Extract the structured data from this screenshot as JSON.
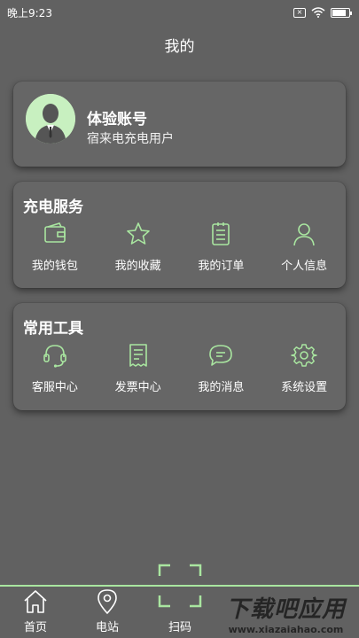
{
  "status_bar": {
    "time": "晚上9:23",
    "sim_label": "×"
  },
  "header": {
    "title": "我的"
  },
  "account": {
    "name": "体验账号",
    "subtitle": "宿来电充电用户"
  },
  "charging_service": {
    "title": "充电服务",
    "items": [
      {
        "label": "我的钱包",
        "icon": "wallet-icon"
      },
      {
        "label": "我的收藏",
        "icon": "star-icon"
      },
      {
        "label": "我的订单",
        "icon": "order-icon"
      },
      {
        "label": "个人信息",
        "icon": "person-icon"
      }
    ]
  },
  "tools": {
    "title": "常用工具",
    "items": [
      {
        "label": "客服中心",
        "icon": "headset-icon"
      },
      {
        "label": "发票中心",
        "icon": "invoice-icon"
      },
      {
        "label": "我的消息",
        "icon": "message-icon"
      },
      {
        "label": "系统设置",
        "icon": "gear-icon"
      }
    ]
  },
  "bottom_nav": {
    "home": "首页",
    "station": "电站",
    "scan": "扫码"
  },
  "watermark": {
    "title": "下载吧应用",
    "url": "www.xiazaiahao.com"
  },
  "colors": {
    "accent": "#a9e6a0",
    "background": "#616161",
    "card": "#666666"
  }
}
